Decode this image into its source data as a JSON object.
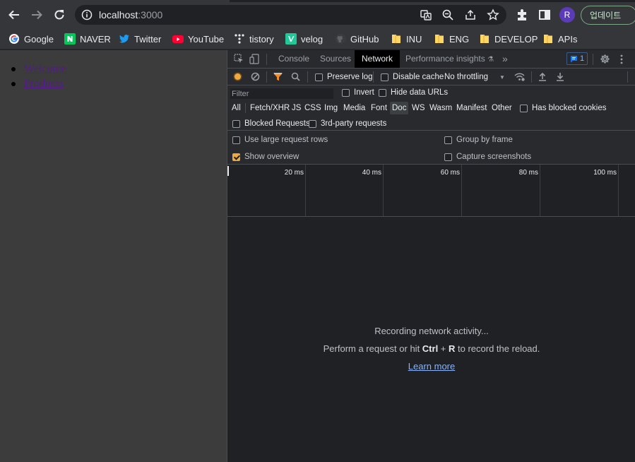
{
  "browser": {
    "url_host": "localhost",
    "url_port": ":3000",
    "avatar_letter": "R",
    "update_label": "업데이트",
    "accent_color": "#8ab4f8"
  },
  "bookmarks": [
    {
      "label": "Google",
      "icon": "google-icon"
    },
    {
      "label": "NAVER",
      "icon": "naver-icon"
    },
    {
      "label": "Twitter",
      "icon": "twitter-icon"
    },
    {
      "label": "YouTube",
      "icon": "youtube-icon"
    },
    {
      "label": "tistory",
      "icon": "tistory-icon"
    },
    {
      "label": "velog",
      "icon": "velog-icon"
    },
    {
      "label": "GitHub",
      "icon": "github-icon"
    },
    {
      "label": "INU",
      "icon": "folder-icon"
    },
    {
      "label": "ENG",
      "icon": "folder-icon"
    },
    {
      "label": "DEVELOP",
      "icon": "folder-icon"
    },
    {
      "label": "APIs",
      "icon": "folder-icon"
    }
  ],
  "page": {
    "links": [
      "Welcome",
      "Products"
    ]
  },
  "devtools": {
    "tabs": [
      "Console",
      "Sources",
      "Network",
      "Performance insights"
    ],
    "active_tab": "Network",
    "issues_count": "1",
    "toolbar": {
      "preserve_log": "Preserve log",
      "disable_cache": "Disable cache",
      "throttling": "No throttling"
    },
    "filter": {
      "placeholder": "Filter",
      "invert": "Invert",
      "hide_data_urls": "Hide data URLs",
      "types": [
        "All",
        "Fetch/XHR",
        "JS",
        "CSS",
        "Img",
        "Media",
        "Font",
        "Doc",
        "WS",
        "Wasm",
        "Manifest",
        "Other"
      ],
      "active_type": "Doc",
      "has_blocked_cookies": "Has blocked cookies",
      "blocked_requests": "Blocked Requests",
      "third_party": "3rd-party requests"
    },
    "settings": {
      "large_rows": "Use large request rows",
      "group_by_frame": "Group by frame",
      "show_overview": "Show overview",
      "show_overview_checked": true,
      "capture_screenshots": "Capture screenshots"
    },
    "timeline": {
      "ticks": [
        "20 ms",
        "40 ms",
        "60 ms",
        "80 ms",
        "100 ms"
      ]
    },
    "empty_state": {
      "recording": "Recording network activity...",
      "hint_before": "Perform a request or hit ",
      "hint_key1": "Ctrl",
      "hint_plus": " + ",
      "hint_key2": "R",
      "hint_after": " to record the reload.",
      "learn_more": "Learn more"
    }
  }
}
